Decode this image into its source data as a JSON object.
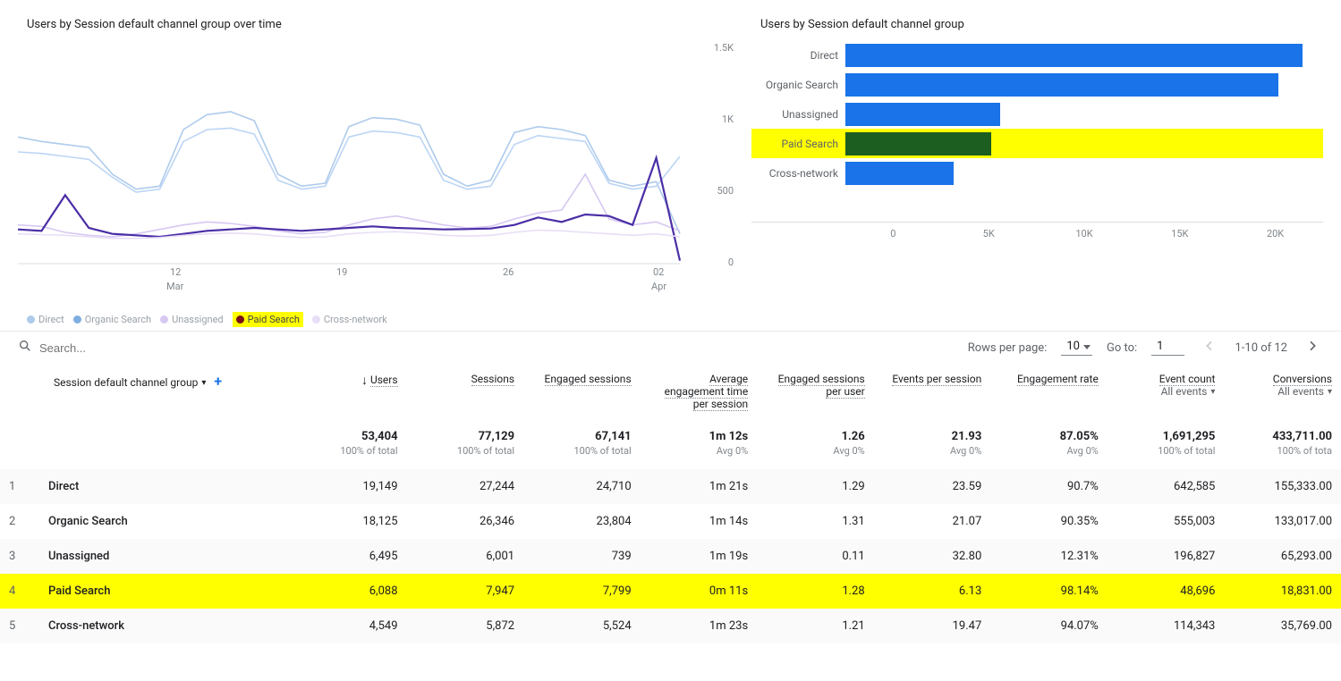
{
  "leftChart": {
    "title": "Users by Session default channel group over time"
  },
  "rightChart": {
    "title": "Users by Session default channel group"
  },
  "legend": {
    "direct": "Direct",
    "organic": "Organic Search",
    "unassigned": "Unassigned",
    "paid": "Paid Search",
    "cross": "Cross-network"
  },
  "chart_data": [
    {
      "type": "line",
      "title": "Users by Session default channel group over time",
      "ylabel": "",
      "ylim": [
        0,
        1500
      ],
      "x_ticks": [
        {
          "label": "12",
          "sub": "Mar"
        },
        {
          "label": "19",
          "sub": ""
        },
        {
          "label": "26",
          "sub": ""
        },
        {
          "label": "02",
          "sub": "Apr"
        }
      ],
      "y_ticks": [
        "0",
        "500",
        "1K",
        "1.5K"
      ],
      "series": [
        {
          "name": "Direct",
          "color": "#aecbeb",
          "values": [
            850,
            820,
            800,
            780,
            600,
            500,
            520,
            900,
            1000,
            1020,
            960,
            600,
            520,
            540,
            920,
            980,
            970,
            930,
            600,
            520,
            560,
            880,
            920,
            900,
            860,
            560,
            520,
            550,
            200
          ]
        },
        {
          "name": "Organic Search",
          "color": "#bcd5f5",
          "values": [
            750,
            740,
            720,
            700,
            580,
            480,
            500,
            820,
            900,
            910,
            870,
            560,
            500,
            520,
            850,
            890,
            880,
            850,
            560,
            500,
            520,
            800,
            860,
            840,
            820,
            540,
            500,
            520,
            720
          ]
        },
        {
          "name": "Unassigned",
          "color": "#d7c8f2",
          "values": [
            260,
            250,
            210,
            190,
            180,
            200,
            230,
            260,
            280,
            270,
            250,
            220,
            200,
            210,
            260,
            300,
            320,
            290,
            260,
            240,
            250,
            300,
            340,
            360,
            600,
            300,
            260,
            280,
            220
          ]
        },
        {
          "name": "Paid Search",
          "color": "#4b2ea6",
          "values": [
            230,
            220,
            460,
            240,
            200,
            190,
            180,
            200,
            220,
            230,
            240,
            230,
            220,
            230,
            240,
            250,
            240,
            235,
            230,
            232,
            236,
            260,
            310,
            280,
            330,
            320,
            260,
            710,
            20
          ]
        },
        {
          "name": "Cross-network",
          "color": "#e8def7",
          "values": [
            200,
            195,
            190,
            180,
            170,
            170,
            175,
            190,
            200,
            205,
            200,
            185,
            175,
            180,
            200,
            210,
            215,
            205,
            190,
            185,
            190,
            210,
            225,
            220,
            210,
            200,
            190,
            200,
            180
          ]
        }
      ]
    },
    {
      "type": "bar",
      "title": "Users by Session default channel group",
      "categories": [
        "Direct",
        "Organic Search",
        "Unassigned",
        "Paid Search",
        "Cross-network"
      ],
      "values": [
        19149,
        18125,
        6495,
        6088,
        4549
      ],
      "xlim": [
        0,
        20000
      ],
      "x_ticks": [
        "0",
        "5K",
        "10K",
        "15K",
        "20K"
      ],
      "highlighted_index": 3
    }
  ],
  "controls": {
    "search_placeholder": "Search...",
    "rows_label": "Rows per page:",
    "rows_value": "10",
    "goto_label": "Go to:",
    "goto_value": "1",
    "range": "1-10 of 12"
  },
  "table": {
    "dimension": "Session default channel group",
    "headers": {
      "users": "Users",
      "sessions": "Sessions",
      "engaged": "Engaged sessions",
      "avg_engage": "Average engagement time per session",
      "eng_per_user": "Engaged sessions per user",
      "events_per": "Events per session",
      "eng_rate": "Engagement rate",
      "event_count": "Event count",
      "event_count_sub": "All events",
      "conversions": "Conversions",
      "conversions_sub": "All events"
    },
    "totals": {
      "users": "53,404",
      "sessions": "77,129",
      "engaged": "67,141",
      "avg": "1m 12s",
      "epu": "1.26",
      "eps": "21.93",
      "rate": "87.05%",
      "ec": "1,691,295",
      "conv": "433,711.00",
      "sub": {
        "pct": "100% of total",
        "avg": "Avg 0%"
      }
    },
    "rows": [
      {
        "i": "1",
        "name": "Direct",
        "users": "19,149",
        "sessions": "27,244",
        "engaged": "24,710",
        "avg": "1m 21s",
        "epu": "1.29",
        "eps": "23.59",
        "rate": "90.7%",
        "ec": "642,585",
        "conv": "155,333.00"
      },
      {
        "i": "2",
        "name": "Organic Search",
        "users": "18,125",
        "sessions": "26,346",
        "engaged": "23,804",
        "avg": "1m 14s",
        "epu": "1.31",
        "eps": "21.07",
        "rate": "90.35%",
        "ec": "555,003",
        "conv": "133,017.00"
      },
      {
        "i": "3",
        "name": "Unassigned",
        "users": "6,495",
        "sessions": "6,001",
        "engaged": "739",
        "avg": "1m 19s",
        "epu": "0.11",
        "eps": "32.80",
        "rate": "12.31%",
        "ec": "196,827",
        "conv": "65,293.00"
      },
      {
        "i": "4",
        "name": "Paid Search",
        "users": "6,088",
        "sessions": "7,947",
        "engaged": "7,799",
        "avg": "0m 11s",
        "epu": "1.28",
        "eps": "6.13",
        "rate": "98.14%",
        "ec": "48,696",
        "conv": "18,831.00",
        "hl": true
      },
      {
        "i": "5",
        "name": "Cross-network",
        "users": "4,549",
        "sessions": "5,872",
        "engaged": "5,524",
        "avg": "1m 23s",
        "epu": "1.21",
        "eps": "19.47",
        "rate": "94.07%",
        "ec": "114,343",
        "conv": "35,769.00"
      }
    ]
  }
}
